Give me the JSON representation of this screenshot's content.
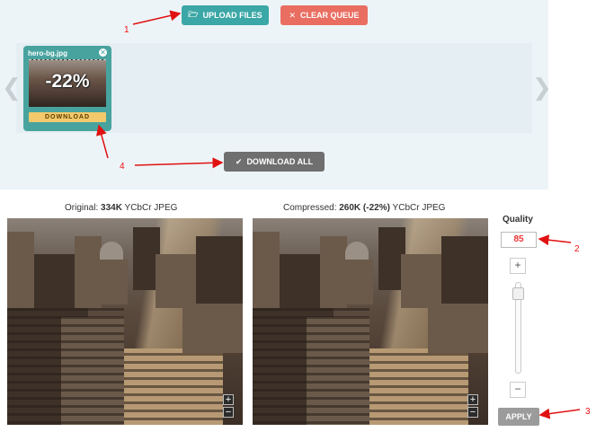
{
  "toolbar": {
    "upload_label": "UPLOAD FILES",
    "clear_label": "CLEAR QUEUE",
    "upload_icon": "folder-icon",
    "clear_icon": "close-icon"
  },
  "queue": {
    "items": [
      {
        "filename": "hero-bg.jpg",
        "reduction": "-22%",
        "download_label": "DOWNLOAD"
      }
    ]
  },
  "download_all": {
    "label": "DOWNLOAD ALL",
    "icon": "check-icon"
  },
  "compare": {
    "original_prefix": "Original: ",
    "original_size": "334K",
    "original_suffix": " YCbCr JPEG",
    "compressed_prefix": "Compressed: ",
    "compressed_size": "260K (-22%)",
    "compressed_suffix": " YCbCr JPEG"
  },
  "quality": {
    "label": "Quality",
    "value": "85",
    "plus": "+",
    "minus": "−",
    "apply_label": "APPLY"
  },
  "annotations": [
    "1",
    "2",
    "3",
    "4"
  ],
  "colors": {
    "upload": "#3ba7a6",
    "clear": "#e96e61",
    "download_all": "#6f6f6f",
    "card": "#48a39f",
    "card_download": "#f3c96b",
    "annotation": "#e11111"
  }
}
